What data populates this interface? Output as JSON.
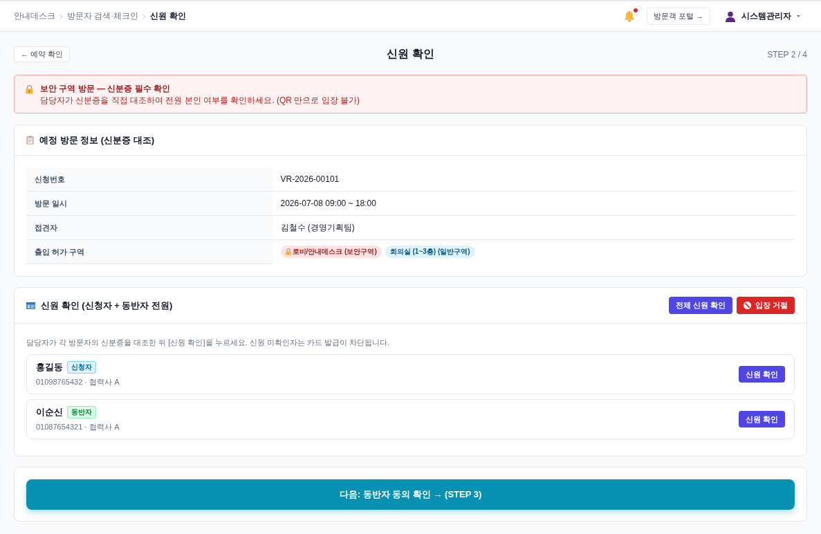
{
  "topbar": {
    "breadcrumb": [
      {
        "label": "안내데스크",
        "current": false
      },
      {
        "label": "방문자 검색·체크인",
        "current": false
      },
      {
        "label": "신원 확인",
        "current": true
      }
    ],
    "notification": {
      "unread": true
    },
    "portal_button": "방문객 포털 →",
    "user": {
      "name": "시스템관리자"
    }
  },
  "page_header": {
    "back_button": "← 예약 확인",
    "title": "신원 확인",
    "step": "STEP 2 / 4"
  },
  "alert": {
    "title": "보안 구역 방문 — 신분증 필수 확인",
    "message": "담당자가 신분증을 직접 대조하여 전원 본인 여부를 확인하세요. (QR 만으로 입장 불가)"
  },
  "visit_info": {
    "title": "예정 방문 정보 (신분증 대조)",
    "rows": [
      {
        "label": "신청번호",
        "value": "VR-2026-00101"
      },
      {
        "label": "방문 일시",
        "value": "2026-07-08 09:00 ~ 18:00"
      },
      {
        "label": "접견자",
        "value": "김철수 (경영기획팀)"
      },
      {
        "label": "출입 허가 구역",
        "zones": [
          {
            "label": "로비/안내데스크 (보안구역)",
            "kind": "secure"
          },
          {
            "label": "회의실 (1~3층) (일반구역)",
            "kind": "general"
          }
        ]
      }
    ]
  },
  "identity": {
    "title": "신원 확인 (신청자 + 동반자 전원)",
    "actions": [
      {
        "label": "전체 신원 확인",
        "kind": "confirm"
      },
      {
        "label": "입장 거절",
        "kind": "reject"
      }
    ],
    "instruction": "담당자가 각 방문자의 신분증을 대조한 뒤 [신원 확인]을 누르세요. 신원 미확인자는 카드 발급이 차단됩니다.",
    "visitors": [
      {
        "name": "홍길동",
        "role": "신청자",
        "kind": "applicant",
        "detail": "01098765432 · 협력사 A",
        "button": "신원 확인"
      },
      {
        "name": "이순신",
        "role": "동반자",
        "kind": "companion",
        "detail": "01087654321 · 협력사 A",
        "button": "신원 확인"
      }
    ]
  },
  "next_button": "다음: 동반자 동의 확인 → (STEP 3)"
}
